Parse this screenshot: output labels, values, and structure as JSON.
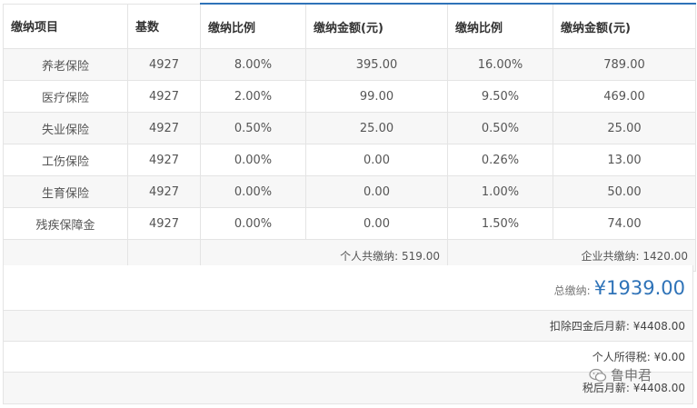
{
  "table": {
    "headers": [
      "缴纳项目",
      "基数",
      "缴纳比例",
      "缴纳金额(元)",
      "缴纳比例",
      "缴纳金额(元)"
    ],
    "rows": [
      [
        "养老保险",
        "4927",
        "8.00%",
        "395.00",
        "16.00%",
        "789.00"
      ],
      [
        "医疗保险",
        "4927",
        "2.00%",
        "99.00",
        "9.50%",
        "469.00"
      ],
      [
        "失业保险",
        "4927",
        "0.50%",
        "25.00",
        "0.50%",
        "25.00"
      ],
      [
        "工伤保险",
        "4927",
        "0.00%",
        "0.00",
        "0.26%",
        "13.00"
      ],
      [
        "生育保险",
        "4927",
        "0.00%",
        "0.00",
        "1.00%",
        "50.00"
      ],
      [
        "残疾保障金",
        "4927",
        "0.00%",
        "0.00",
        "1.50%",
        "74.00"
      ]
    ],
    "personal_total": "个人共缴纳: 519.00",
    "company_total": "企业共缴纳: 1420.00"
  },
  "summary": {
    "total_label": "总缴纳:",
    "total_value": "¥1939.00",
    "after_funds": "扣除四金后月薪: ¥4408.00",
    "income_tax": "个人所得税: ¥0.00",
    "after_tax": "税后月薪: ¥4408.00"
  },
  "watermark": {
    "text": "鲁申君",
    "icon": "wechat-icon"
  }
}
